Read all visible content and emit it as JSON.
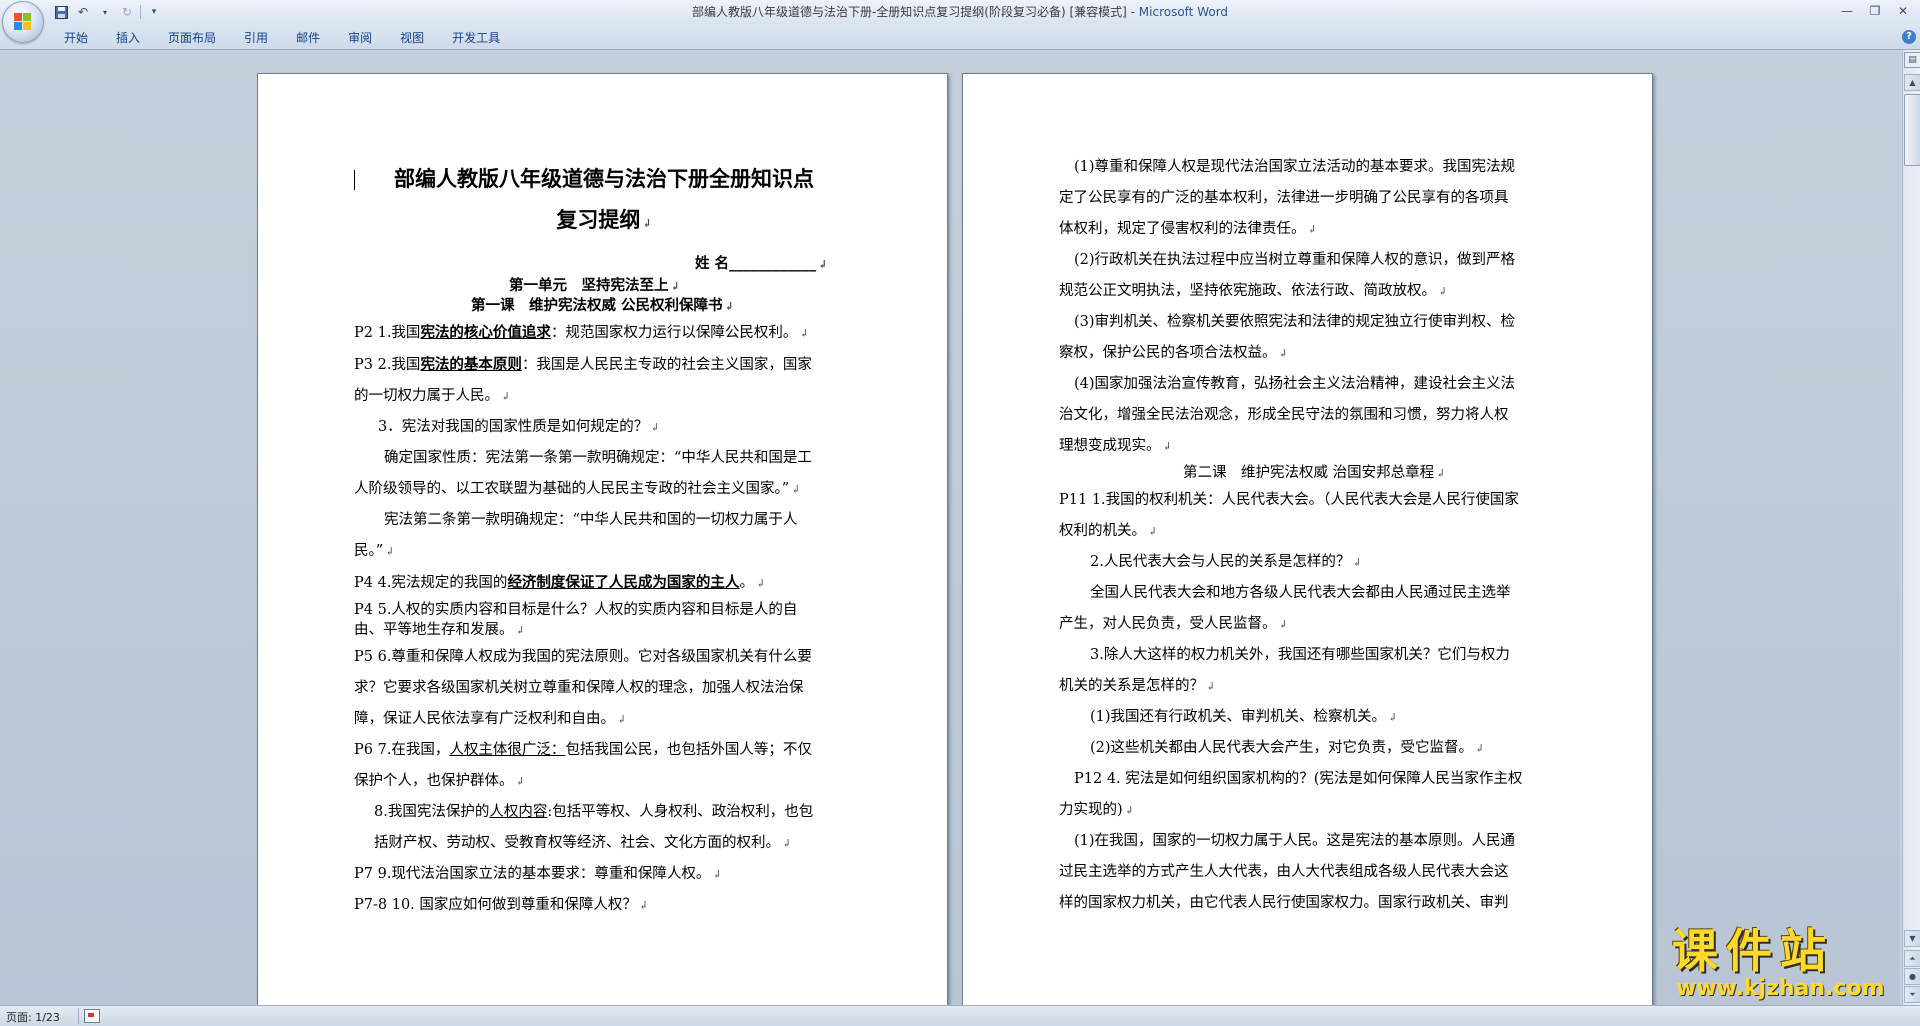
{
  "window": {
    "title": "部编人教版八年级道德与法治下册-全册知识点复习提纲(阶段复习必备) [兼容模式] - ",
    "app_name": "Microsoft Word"
  },
  "quick_access": {
    "save": "save-icon",
    "undo": "undo-icon",
    "redo": "redo-icon",
    "customize": "▾"
  },
  "ribbon_tabs": [
    "开始",
    "插入",
    "页面布局",
    "引用",
    "邮件",
    "审阅",
    "视图",
    "开发工具"
  ],
  "status": {
    "page": "页面: 1/23"
  },
  "watermark": {
    "text": "课件站",
    "url": "www.kjzhan.com"
  },
  "left_page": {
    "title_line1": "部编人教版八年级道德与法治下册全册知识点",
    "title_line2": "复习提纲",
    "name_label": "姓 名",
    "name_blank": "____________",
    "unit": "第一单元　坚持宪法至上",
    "lesson": "第一课　维护宪法权威 公民权利保障书",
    "p1_pre": "P2 1.我国",
    "p1_key": "宪法的核心价值追求",
    "p1_post": "：规范国家权力运行以保障公民权利。",
    "p2_pre": "P3 2.我国",
    "p2_key": "宪法的基本原则",
    "p2_post": "：我国是人民民主专政的社会主义国家，国家",
    "p2_line2": "的一切权力属于人民。",
    "p3": "3．宪法对我国的国家性质是如何规定的？",
    "p4_line1": "确定国家性质：宪法第一条第一款明确规定：“中华人民共和国是工",
    "p4_line2": "人阶级领导的、以工农联盟为基础的人民民主专政的社会主义国家。”",
    "p5_line1": "宪法第二条第一款明确规定：“中华人民共和国的一切权力属于人",
    "p5_line2": "民。”",
    "p6_pre": "P4 4.宪法规定的我国的",
    "p6_key": "经济制度保证了人民成为国家的主人",
    "p6_post": "。",
    "p7_line1": "P4  5.人权的实质内容和目标是什么？人权的实质内容和目标是人的自",
    "p7_line2": "由、平等地生存和发展。",
    "p8_line1": "P5 6.尊重和保障人权成为我国的宪法原则。它对各级国家机关有什么要",
    "p8_line2": "求？它要求各级国家机关树立尊重和保障人权的理念，加强人权法治保",
    "p8_line3": "障，保证人民依法享有广泛权利和自由。",
    "p9_pre": "P6 7.在我国，",
    "p9_key": "人权主体很广泛：",
    "p9_post": "包括我国公民，也包括外国人等；不仅",
    "p9_line2": "保护个人，也保护群体。",
    "p10_pre": "8.我国宪法保护的",
    "p10_key": "人权内容",
    "p10_post": ":包括平等权、人身权利、政治权利，也包",
    "p10_line2": "括财产权、劳动权、受教育权等经济、社会、文化方面的权利。",
    "p11": "P7 9.现代法治国家立法的基本要求：尊重和保障人权。",
    "p12": "P7-8 10.  国家应如何做到尊重和保障人权？"
  },
  "right_page": {
    "r1_line1": "(1)尊重和保障人权是现代法治国家立法活动的基本要求。我国宪法规",
    "r1_line2": "定了公民享有的广泛的基本权利，法律进一步明确了公民享有的各项具",
    "r1_line3": "体权利，规定了侵害权利的法律责任。",
    "r2_line1": "(2)行政机关在执法过程中应当树立尊重和保障人权的意识，做到严格",
    "r2_line2": "规范公正文明执法，坚持依宪施政、依法行政、简政放权。",
    "r3_line1": "(3)审判机关、检察机关要依照宪法和法律的规定独立行使审判权、检",
    "r3_line2": "察权，保护公民的各项合法权益。",
    "r4_line1": "(4)国家加强法治宣传教育，弘扬社会主义法治精神，建设社会主义法",
    "r4_line2": "治文化，增强全民法治观念，形成全民守法的氛围和习惯，努力将人权",
    "r4_line3": "理想变成现实。",
    "lesson2": "第二课　维护宪法权威  治国安邦总章程",
    "r5_line1": "P11 1.我国的权利机关：人民代表大会。（人民代表大会是人民行使国家",
    "r5_line2": "权利的机关。",
    "r6": "2.人民代表大会与人民的关系是怎样的？",
    "r7_line1": "全国人民代表大会和地方各级人民代表大会都由人民通过民主选举",
    "r7_line2": "产生，对人民负责，受人民监督。",
    "r8_line1": "3.除人大这样的权力机关外，我国还有哪些国家机关？它们与权力",
    "r8_line2": "机关的关系是怎样的？",
    "r9": "(1)我国还有行政机关、审判机关、检察机关。",
    "r10": "(2)这些机关都由人民代表大会产生，对它负责，受它监督。",
    "r11_line1": "P12 4. 宪法是如何组织国家机构的？(宪法是如何保障人民当家作主权",
    "r11_line2": "力实现的)",
    "r12_line1": "(1)在我国，国家的一切权力属于人民。这是宪法的基本原则。人民通",
    "r12_line2": "过民主选举的方式产生人大代表，由人大代表组成各级人民代表大会这",
    "r12_line3": "样的国家权力机关，由它代表人民行使国家权力。国家行政机关、审判"
  }
}
